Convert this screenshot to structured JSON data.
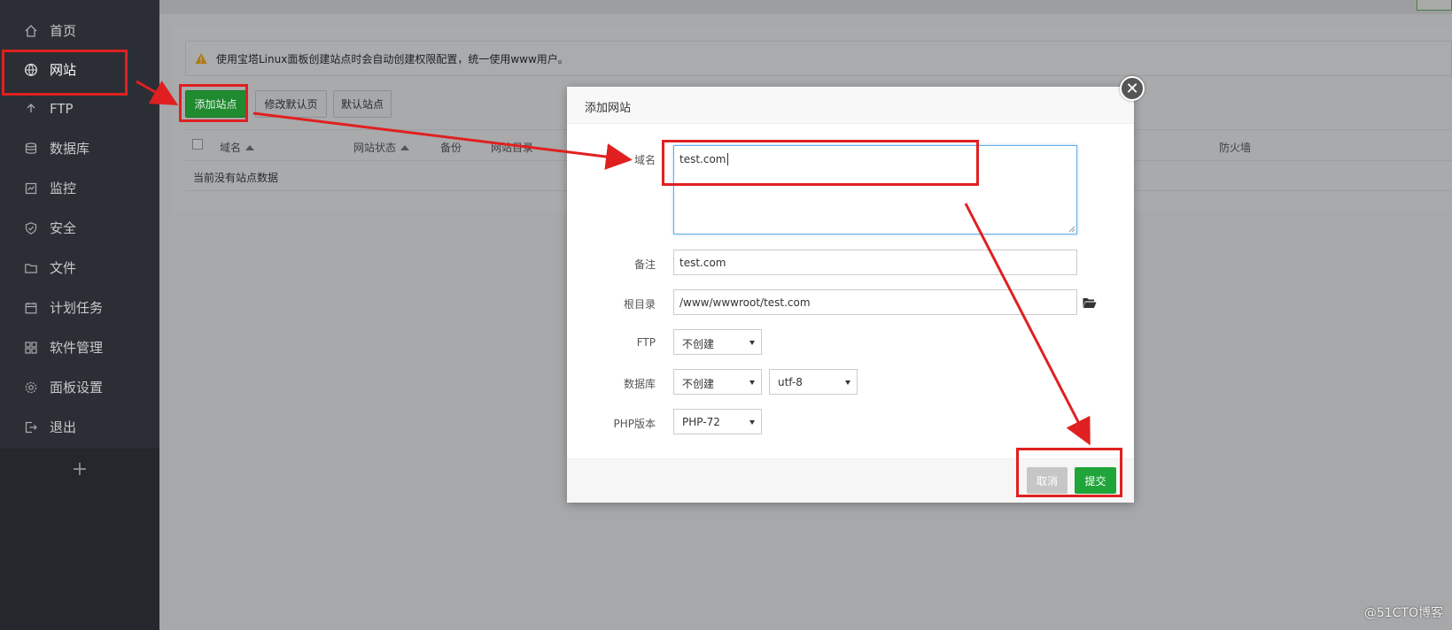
{
  "sidebar": {
    "items": [
      {
        "label": "首页",
        "icon": "home-icon"
      },
      {
        "label": "网站",
        "icon": "globe-icon"
      },
      {
        "label": "FTP",
        "icon": "upload-icon"
      },
      {
        "label": "数据库",
        "icon": "database-icon"
      },
      {
        "label": "监控",
        "icon": "monitor-icon"
      },
      {
        "label": "安全",
        "icon": "shield-icon"
      },
      {
        "label": "文件",
        "icon": "folder-icon"
      },
      {
        "label": "计划任务",
        "icon": "calendar-icon"
      },
      {
        "label": "软件管理",
        "icon": "apps-icon"
      },
      {
        "label": "面板设置",
        "icon": "gear-icon"
      },
      {
        "label": "退出",
        "icon": "logout-icon"
      }
    ],
    "add_symbol": "+"
  },
  "notice": {
    "text": "使用宝塔Linux面板创建站点时会自动创建权限配置，统一使用www用户。"
  },
  "toolbar": {
    "add_site": "添加站点",
    "edit_default_page": "修改默认页",
    "default_site": "默认站点"
  },
  "table": {
    "headers": [
      "域名",
      "网站状态",
      "备份",
      "网站目录",
      "防火墙"
    ],
    "empty_text": "当前没有站点数据"
  },
  "modal": {
    "title": "添加网站",
    "close": "✕",
    "fields": {
      "domain_label": "域名",
      "domain_value": "test.com",
      "remark_label": "备注",
      "remark_value": "test.com",
      "root_label": "根目录",
      "root_value": "/www/wwwroot/test.com",
      "ftp_label": "FTP",
      "ftp_value": "不创建",
      "db_label": "数据库",
      "db_value": "不创建",
      "charset_value": "utf-8",
      "php_label": "PHP版本",
      "php_value": "PHP-72"
    },
    "cancel": "取消",
    "submit": "提交"
  },
  "watermark": "@51CTO博客",
  "colors": {
    "annotation_red": "#e02020",
    "submit_green": "#20a53a",
    "sidebar_bg": "#2b2f35"
  }
}
